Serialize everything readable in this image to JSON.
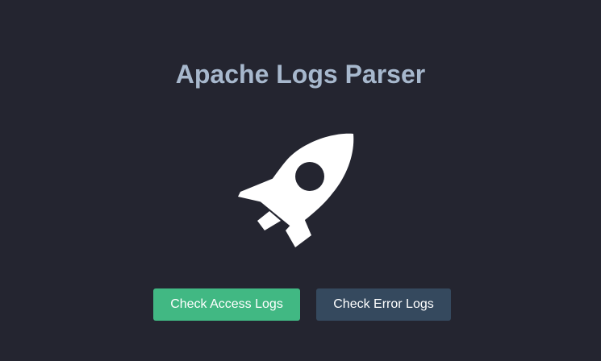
{
  "app": {
    "title": "Apache Logs Parser"
  },
  "hero": {
    "icon": "rocket-icon",
    "icon_color": "#ffffff"
  },
  "actions": {
    "access_logs_label": "Check Access Logs",
    "error_logs_label": "Check Error Logs"
  },
  "colors": {
    "background": "#242530",
    "title": "#a7b8cd",
    "access_button": "#41b883",
    "error_button": "#35495e"
  }
}
